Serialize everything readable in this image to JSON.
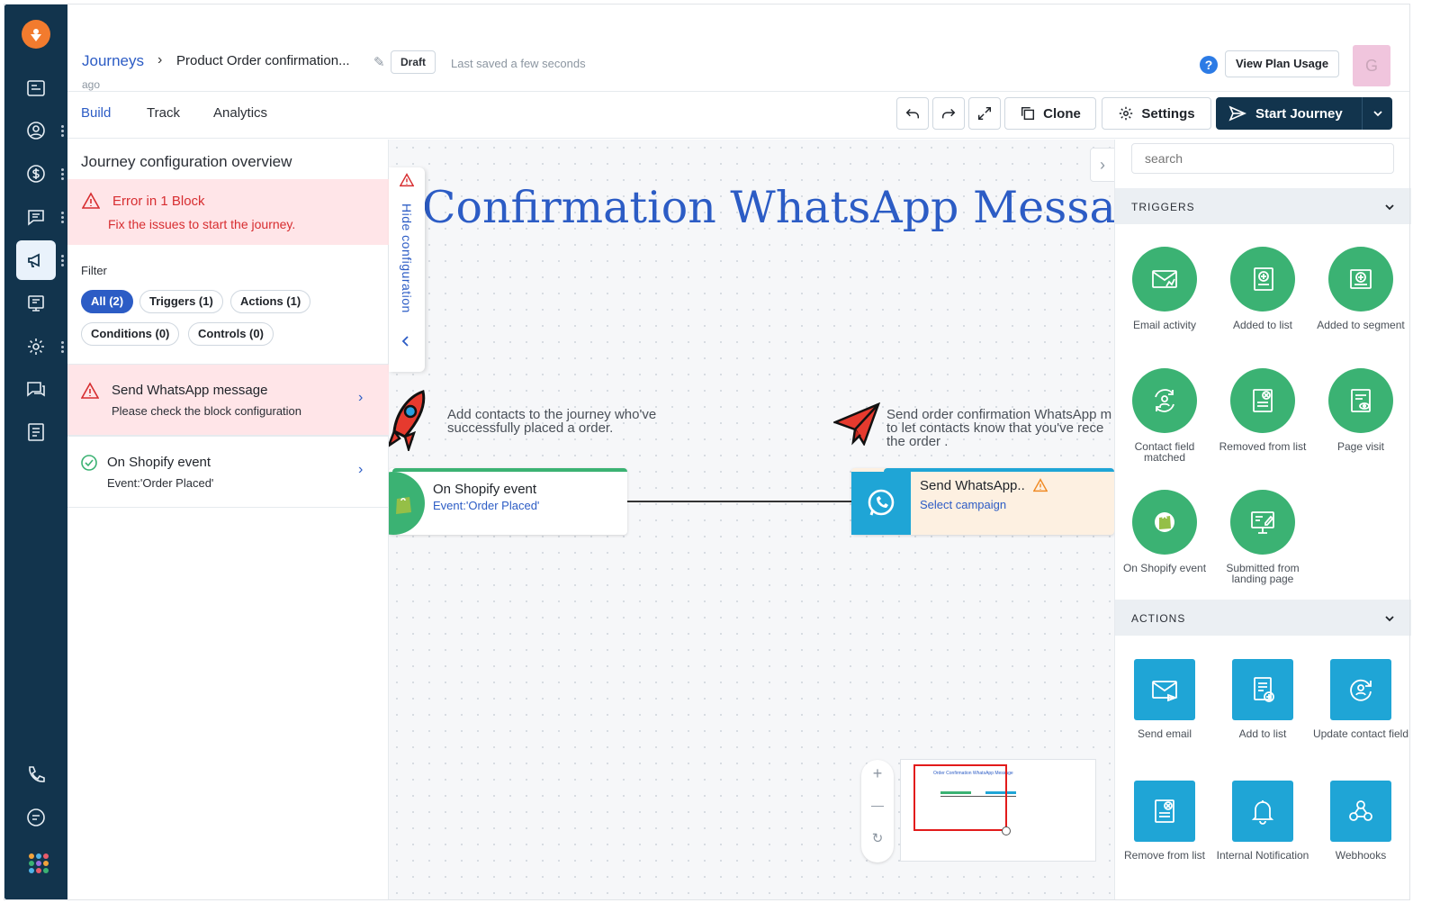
{
  "header": {
    "breadcrumb_root": "Journeys",
    "breadcrumb_sep": "›",
    "journey_title": "Product Order confirmation...",
    "status_badge": "Draft",
    "last_saved": "Last saved a few seconds",
    "last_saved_cont": "ago",
    "help_label": "?",
    "plan_usage_label": "View Plan Usage",
    "avatar_initial": "G"
  },
  "tabs": [
    {
      "label": "Build",
      "active": true
    },
    {
      "label": "Track",
      "active": false
    },
    {
      "label": "Analytics",
      "active": false
    }
  ],
  "toolbar": {
    "clone_label": "Clone",
    "settings_label": "Settings",
    "start_label": "Start Journey"
  },
  "config": {
    "title": "Journey configuration overview",
    "error_title": "Error in 1 Block",
    "error_sub": "Fix the issues to start the journey.",
    "filter_label": "Filter",
    "filters": [
      {
        "label": "All (2)",
        "active": true
      },
      {
        "label": "Triggers (1)",
        "active": false
      },
      {
        "label": "Actions (1)",
        "active": false
      },
      {
        "label": "Conditions (0)",
        "active": false
      },
      {
        "label": "Controls (0)",
        "active": false
      }
    ],
    "items": [
      {
        "title": "Send WhatsApp message",
        "sub": "Please check the block configuration",
        "status": "error"
      },
      {
        "title": "On Shopify event",
        "sub": "Event:'Order Placed'",
        "status": "ok"
      }
    ],
    "hide_label": "Hide configuration"
  },
  "canvas": {
    "title": "Confirmation WhatsApp Messag",
    "note_left_1": "Add contacts to the journey who've",
    "note_left_2": "successfully placed a order.",
    "note_right_1": "Send order confirmation WhatsApp m",
    "note_right_2": "to let contacts know that you've rece",
    "note_right_3": "the order .",
    "node_trigger": {
      "title": "On Shopify event",
      "sub": "Event:'Order Placed'"
    },
    "node_action": {
      "title": "Send WhatsApp..",
      "sub": "Select campaign"
    },
    "minimap_caption": "Order Confirmation WhatsApp Message",
    "zoom_in": "+",
    "zoom_out": "—",
    "zoom_reset": "↻",
    "collapse": "›"
  },
  "palette": {
    "search_placeholder": "search",
    "triggers_label": "TRIGGERS",
    "actions_label": "ACTIONS",
    "triggers": [
      {
        "label": "Email activity",
        "icon": "email-activity-icon"
      },
      {
        "label": "Added to list",
        "icon": "added-to-list-icon"
      },
      {
        "label": "Added to segment",
        "icon": "added-to-segment-icon"
      },
      {
        "label": "Contact field matched",
        "icon": "contact-field-icon"
      },
      {
        "label": "Removed from list",
        "icon": "removed-from-list-icon"
      },
      {
        "label": "Page visit",
        "icon": "page-visit-icon"
      },
      {
        "label": "On Shopify event",
        "icon": "shopify-icon"
      },
      {
        "label": "Submitted from landing page",
        "icon": "landing-page-icon"
      }
    ],
    "actions": [
      {
        "label": "Send email",
        "icon": "send-email-icon"
      },
      {
        "label": "Add to list",
        "icon": "add-to-list-icon"
      },
      {
        "label": "Update contact field",
        "icon": "update-contact-icon"
      },
      {
        "label": "Remove from list",
        "icon": "remove-from-list-icon"
      },
      {
        "label": "Internal Notification",
        "icon": "bell-icon"
      },
      {
        "label": "Webhooks",
        "icon": "webhooks-icon"
      }
    ]
  },
  "colors": {
    "rail": "#12344d",
    "accent": "#2c5cc5",
    "error": "#d72d30",
    "trigger_green": "#3bb273",
    "action_blue": "#1fa5d6"
  }
}
